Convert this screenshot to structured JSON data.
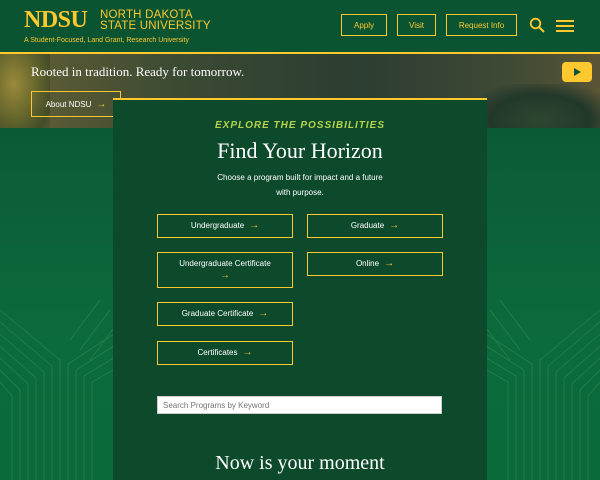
{
  "header": {
    "logo_text": "NDSU",
    "university_name_line1": "NORTH DAKOTA",
    "university_name_line2": "STATE UNIVERSITY",
    "tagline": "A Student-Focused, Land Grant, Research University",
    "nav": [
      {
        "label": "Apply"
      },
      {
        "label": "Visit"
      },
      {
        "label": "Request Info"
      }
    ],
    "search_icon": "search-icon",
    "menu_icon": "hamburger-menu-icon"
  },
  "hero": {
    "headline": "Rooted in tradition. Ready for tomorrow.",
    "button_label": "About NDSU",
    "play_icon": "play-icon"
  },
  "explore": {
    "eyebrow": "EXPLORE THE POSSIBILITIES",
    "title": "Find Your Horizon",
    "description": "Choose a program built for impact and a future with purpose.",
    "programs": [
      {
        "label": "Undergraduate"
      },
      {
        "label": "Graduate"
      },
      {
        "label": "Undergraduate Certificate"
      },
      {
        "label": "Online"
      },
      {
        "label": "Graduate Certificate"
      },
      {
        "label": "Certificates"
      }
    ],
    "search_placeholder": "Search Programs by Keyword"
  },
  "next_section": {
    "title": "Now is your moment"
  },
  "colors": {
    "brand_green": "#0a5431",
    "brand_gold": "#ffc82e",
    "card_green": "#0d4a2b",
    "accent_lime": "#b7d24a"
  }
}
